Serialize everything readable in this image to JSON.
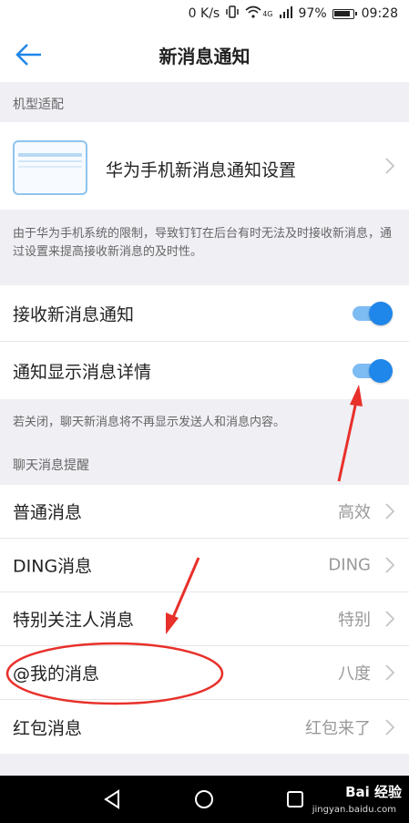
{
  "status_bar": {
    "speed": "0 K/s",
    "network": "4G",
    "battery": "97%",
    "time": "09:28"
  },
  "header": {
    "title": "新消息通知"
  },
  "section_model": {
    "header": "机型适配",
    "huawei_label": "华为手机新消息通知设置",
    "description": "由于华为手机系统的限制，导致钉钉在后台有时无法及时接收新消息，通过设置来提高接收新消息的及时性。"
  },
  "notifications": {
    "receive_label": "接收新消息通知",
    "receive_on": true,
    "detail_label": "通知显示消息详情",
    "detail_on": true,
    "description": "若关闭，聊天新消息将不再显示发送人和消息内容。"
  },
  "chat_alerts": {
    "header": "聊天消息提醒",
    "items": [
      {
        "label": "普通消息",
        "value": "高效"
      },
      {
        "label": "DING消息",
        "value": "DING"
      },
      {
        "label": "特别关注人消息",
        "value": "特别"
      },
      {
        "label": "@我的消息",
        "value": "八度"
      },
      {
        "label": "红包消息",
        "value": "红包来了"
      }
    ]
  },
  "watermark": {
    "brand": "Bai 经验",
    "url": "jingyan.baidu.com"
  },
  "colors": {
    "accent": "#1f86ea",
    "annotation": "#e8302a"
  }
}
